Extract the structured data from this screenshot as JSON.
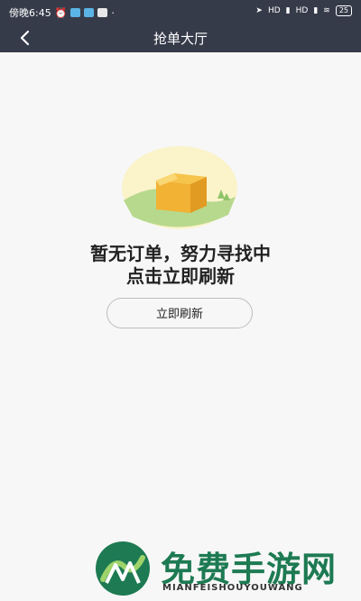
{
  "status_bar": {
    "time": "傍晚6:45",
    "signal_1": "HD",
    "signal_2": "HD",
    "battery": "25"
  },
  "nav": {
    "title": "抢单大厅"
  },
  "empty_state": {
    "title": "暂无订单，努力寻找中",
    "subtitle": "点击立即刷新",
    "refresh_label": "立即刷新"
  },
  "watermark": {
    "title": "免费手游网",
    "subtitle": "MIANFEISHOUYOUWANG"
  }
}
